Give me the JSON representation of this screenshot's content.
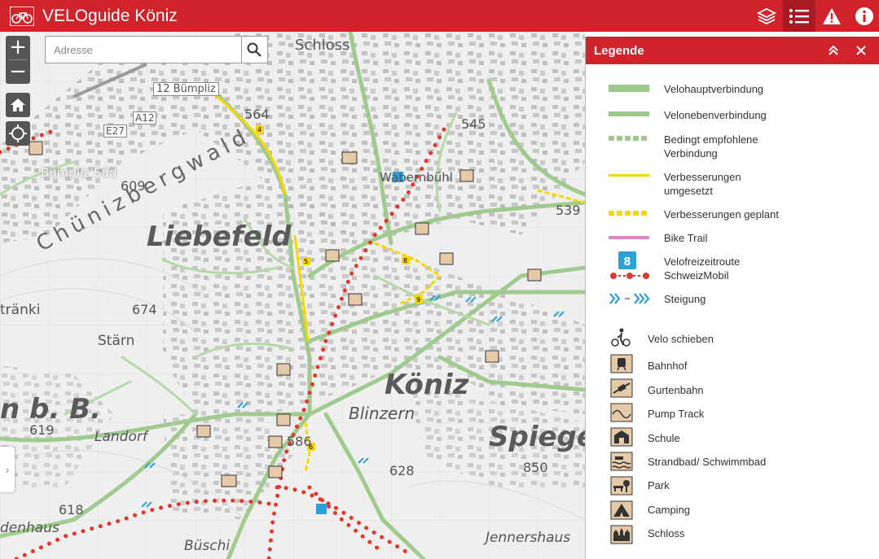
{
  "app": {
    "title": "VELOguide Köniz"
  },
  "header": {
    "layers_icon": "layers-icon",
    "legend_icon": "list-icon",
    "warning_icon": "warning-icon",
    "info_icon": "info-icon"
  },
  "map": {
    "search_placeholder": "Adresse",
    "zoom_in": "+",
    "zoom_out": "−",
    "labels": {
      "liebefeld": "Liebefeld",
      "koniz": "Köniz",
      "spiegel": "Spiegel",
      "chunizbergwald": "Chünizbergwald",
      "bumpliz_sud": "Bümpliz Süd",
      "schloss": "Schloss",
      "blinzern": "Blinzern",
      "landorf": "Landorf",
      "stairn": "Stärn",
      "buschi": "Büschi",
      "jennershaus": "Jennershaus",
      "denhaus": "denhaus",
      "nbb": "n b. B.",
      "tranki": "tränki",
      "wabernbuhl": "Wabernbühl",
      "signpost": "12 Bümpliz",
      "e27": "E27",
      "a12": "A12",
      "h564": "564",
      "h545": "545",
      "h609": "609",
      "h539": "539",
      "h674": "674",
      "h619": "619",
      "h628": "628",
      "h850": "850",
      "h618": "618",
      "h586": "586"
    },
    "markers": [
      "4",
      "5",
      "6",
      "8",
      "9"
    ]
  },
  "legend": {
    "title": "Legende",
    "items": [
      {
        "label": "Velohauptverbindung",
        "color": "#9dc98a"
      },
      {
        "label": "Velonebenverbindung",
        "color": "#9dc98a"
      },
      {
        "label": "Bedingt empfohlene Verbindung",
        "color": "#9dc98a"
      },
      {
        "label": "Verbesserungen umgesetzt",
        "color": "#f5d800"
      },
      {
        "label": "Verbesserungen geplant",
        "color": "#f5d800"
      },
      {
        "label": "Bike Trail",
        "color": "#d98bbf"
      },
      {
        "label": "Velofreizeitroute SchweizMobil",
        "color": "#e0392b"
      },
      {
        "label": "Steigung",
        "color": "#2aa1d8"
      },
      {
        "label": "Velo schieben"
      },
      {
        "label": "Bahnhof"
      },
      {
        "label": "Gurtenbahn"
      },
      {
        "label": "Pump Track"
      },
      {
        "label": "Schule"
      },
      {
        "label": "Strandbad/ Schwimmbad"
      },
      {
        "label": "Park"
      },
      {
        "label": "Camping"
      },
      {
        "label": "Schloss"
      }
    ]
  }
}
